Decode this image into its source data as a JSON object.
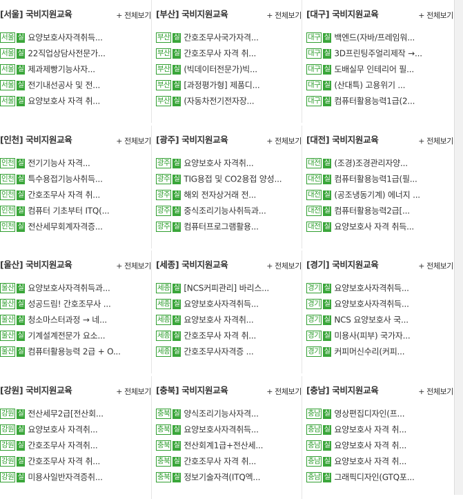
{
  "more_label": "+ 전체보기",
  "colors": {
    "badge_green": "#2f9e2f",
    "square_green": "#3aa63a"
  },
  "blocks": [
    {
      "title": "[서울] 국비지원교육",
      "region": "서울",
      "items": [
        "요양보호사자격취득...",
        "22직업상담사전문가...",
        "제과제빵기능사자...",
        "전기내선공사 및 전...",
        "요양보호사 자격 취..."
      ]
    },
    {
      "title": "[부산] 국비지원교육",
      "region": "부산",
      "items": [
        "간호조무사국가자격...",
        "간호조무사 자격 취...",
        "(빅데이터전문가)빅...",
        "[과정평가형] 제품디...",
        "(자동차전기전자장..."
      ]
    },
    {
      "title": "[대구] 국비지원교육",
      "region": "대구",
      "items": [
        "백엔드(자바/프레임워...",
        "3D프린팅주얼리제작 →...",
        "도배실무 인테리어 필...",
        "(산대특) 고용위기 ...",
        "컴퓨터활용능력1급(2..."
      ]
    },
    {
      "title": "[인천] 국비지원교육",
      "region": "인천",
      "items": [
        "전기기능사 자격...",
        "특수용접기능사취득...",
        "간호조무사 자격 취...",
        "컴퓨터 기초부터 ITQ(...",
        "전산세무회계자격증..."
      ]
    },
    {
      "title": "[광주] 국비지원교육",
      "region": "광주",
      "items": [
        "요양보호사 자격취...",
        "TIG용접 및 CO2용접 양성...",
        "해외 전자상거래 전...",
        "중식조리기능사취득과...",
        "컴퓨터프로그램활용..."
      ]
    },
    {
      "title": "[대전] 국비지원교육",
      "region": "대전",
      "items": [
        "(조경)조경관리자양...",
        "컴퓨터활용능력1급(필...",
        "(공조냉동기계) 에너지 ...",
        "컴퓨터활용능력2급[...",
        "요양보호사 자격 취득..."
      ]
    },
    {
      "title": "[울산] 국비지원교육",
      "region": "울산",
      "items": [
        "요양보호사자격취득과...",
        "성공드림! 간호조무사 ...",
        "청소마스터과정 → 네...",
        "기계설계전문가 요소...",
        "컴퓨터활용능력 2급 + O..."
      ]
    },
    {
      "title": "[세종] 국비지원교육",
      "region": "세종",
      "items": [
        "[NCS커피관리] 바리스...",
        "요양보호사자격취득...",
        "요양보호사 자격취...",
        "간호조무사 자격 취...",
        "간호조무사자격증 ..."
      ]
    },
    {
      "title": "[경기] 국비지원교육",
      "region": "경기",
      "items": [
        "요양보호사자격취득...",
        "요양보호사자격취득...",
        "NCS 요양보호사 국...",
        "미용사(피부) 국가자...",
        "커피머신수리(커피..."
      ]
    },
    {
      "title": "[강원] 국비지원교육",
      "region": "강원",
      "items": [
        "전산세무2급[전산회...",
        "요양보호사 자격취...",
        "간호조무사 자격취...",
        "간호조무사 자격 취...",
        "미용사일반자격증취..."
      ]
    },
    {
      "title": "[충북] 국비지원교육",
      "region": "충북",
      "items": [
        "양식조리기능사자격...",
        "요양보호사자격취득...",
        "전산회계1급+전산세...",
        "간호조무사 자격 취...",
        "정보기술자격(ITQ엑..."
      ]
    },
    {
      "title": "[충남] 국비지원교육",
      "region": "충남",
      "items": [
        "영상편집디자인(프...",
        "요양보호사 자격 취...",
        "요양보호사 자격 취...",
        "요양보호사 자격 취...",
        "그래픽디자인(GTQ포..."
      ]
    }
  ],
  "square_badge": "실"
}
